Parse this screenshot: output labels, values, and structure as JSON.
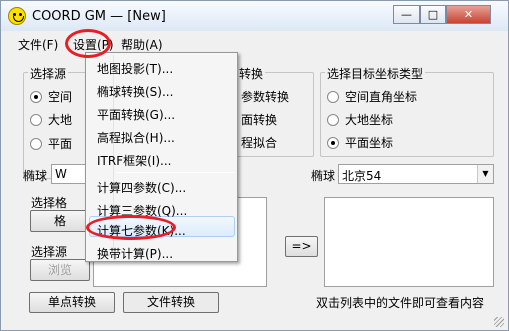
{
  "window": {
    "title": "COORD GM — [New]",
    "minimize": "—",
    "maximize": "□",
    "close": "✕"
  },
  "menubar": {
    "file": "文件(F)",
    "settings": "设置(P)",
    "help": "帮助(A)"
  },
  "settings_menu": {
    "items": [
      "地图投影(T)...",
      "椭球转换(S)...",
      "平面转换(G)...",
      "高程拟合(H)...",
      "ITRF框架(I)...",
      "计算四参数(C)...",
      "计算三参数(Q)...",
      "计算七参数(K)...",
      "换带计算(P)..."
    ]
  },
  "source_group": {
    "title": "选择源",
    "options": [
      "空间",
      "大地",
      "平面"
    ]
  },
  "mid_group": {
    "title": "转换",
    "options": [
      "参数转换",
      "面转换",
      "程拟合"
    ]
  },
  "target_group": {
    "title": "选择目标坐标类型",
    "options": [
      "空间直角坐标",
      "大地坐标",
      "平面坐标"
    ],
    "selected": "平面坐标"
  },
  "left_ellipsoid": {
    "label": "椭球",
    "value": "W"
  },
  "right_ellipsoid": {
    "label": "椭球",
    "value": "北京54"
  },
  "left_lower": {
    "label1": "选择格",
    "button1": "格",
    "label2": "选择源",
    "button2": "浏览"
  },
  "arrow_button": "=>",
  "bottom": {
    "single_button": "单点转换",
    "file_button": "文件转换",
    "hint": "双击列表中的文件即可查看内容"
  }
}
